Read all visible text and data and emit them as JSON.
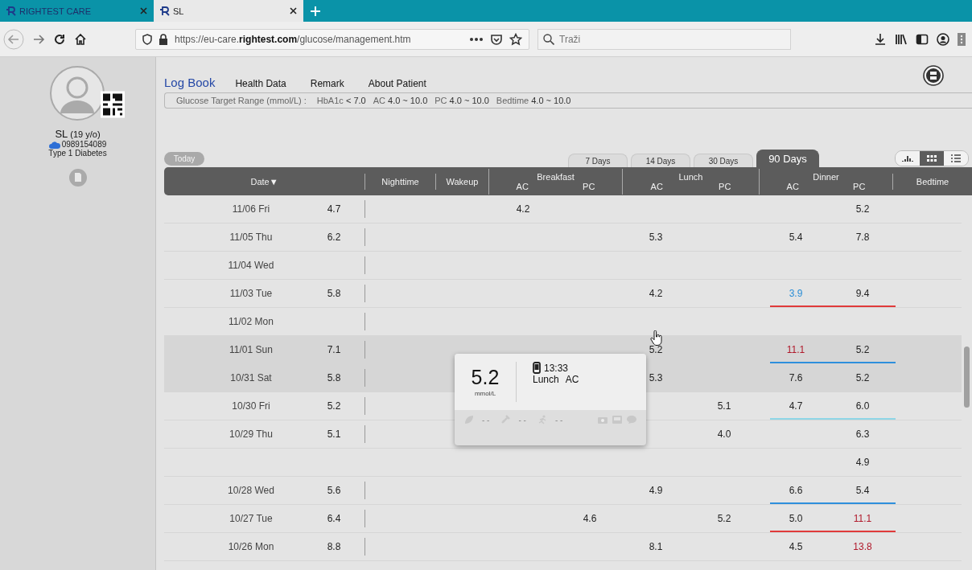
{
  "browser": {
    "tabs": [
      {
        "title": "RIGHTEST CARE",
        "selected": false
      },
      {
        "title": "SL",
        "selected": true
      }
    ],
    "url": "https://eu-care.**rightest.com**/glucose/management.htm",
    "search": {
      "placeholder": "Traži"
    }
  },
  "patient": {
    "name": "SL",
    "age": "(19 y/o)",
    "phone": "0989154089",
    "condition": "Type 1 Diabetes"
  },
  "nav": [
    {
      "label": "Log Book",
      "selected": true
    },
    {
      "label": "Health Data",
      "selected": false
    },
    {
      "label": "Remark",
      "selected": false
    },
    {
      "label": "About Patient",
      "selected": false
    }
  ],
  "target_range": {
    "label": "Glucose Target Range (mmol/L) :",
    "items": [
      {
        "name": "HbA1c",
        "value": "< 7.0"
      },
      {
        "name": "AC",
        "value": "4.0 ~ 10.0"
      },
      {
        "name": "PC",
        "value": "4.0 ~ 10.0"
      },
      {
        "name": "Bedtime",
        "value": "4.0 ~ 10.0"
      }
    ]
  },
  "today_button": "Today",
  "period_tabs": [
    {
      "label": "7 Days",
      "selected": false
    },
    {
      "label": "14 Days",
      "selected": false
    },
    {
      "label": "30 Days",
      "selected": false
    },
    {
      "label": "90 Days",
      "selected": true
    }
  ],
  "view_modes": [
    {
      "kind": "chart",
      "selected": false
    },
    {
      "kind": "grid",
      "selected": true
    },
    {
      "kind": "list",
      "selected": false
    }
  ],
  "table": {
    "date_header": "Date▼",
    "groups": [
      {
        "label": "Nighttime"
      },
      {
        "label": "Wakeup"
      },
      {
        "label": "Breakfast",
        "sub": [
          "AC",
          "PC"
        ]
      },
      {
        "label": "Lunch",
        "sub": [
          "AC",
          "PC"
        ]
      },
      {
        "label": "Dinner",
        "sub": [
          "AC",
          "PC"
        ]
      },
      {
        "label": "Bedtime"
      }
    ],
    "rows": [
      {
        "date": "11/06 Fri",
        "highlighted": false,
        "cells": {
          "column_2": {
            "value": "4.7"
          },
          "breakfast_ac": {
            "value": "4.2"
          },
          "dinner_pc": {
            "value": "5.2"
          }
        }
      },
      {
        "date": "11/05 Thu",
        "highlighted": false,
        "cells": {
          "column_2": {
            "value": "6.2"
          },
          "lunch_ac": {
            "value": "5.3"
          },
          "dinner_ac": {
            "value": "5.4"
          },
          "dinner_pc": {
            "value": "7.8"
          }
        }
      },
      {
        "date": "11/04 Wed",
        "highlighted": false,
        "cells": {}
      },
      {
        "date": "11/03 Tue",
        "highlighted": false,
        "cells": {
          "column_2": {
            "value": "5.8"
          },
          "lunch_ac": {
            "value": "4.2"
          },
          "dinner_ac": {
            "value": "3.9",
            "color": "#2b8ed6"
          },
          "dinner_pc": {
            "value": "9.4"
          }
        },
        "dinner_line": {
          "color": "#e03a3a"
        }
      },
      {
        "date": "11/02 Mon",
        "highlighted": false,
        "cells": {}
      },
      {
        "date": "11/01 Sun",
        "highlighted": true,
        "cells": {
          "column_2": {
            "value": "7.1"
          },
          "lunch_ac": {
            "value": "5.2"
          },
          "dinner_ac": {
            "value": "11.1",
            "color": "#b0182a"
          },
          "dinner_pc": {
            "value": "5.2"
          }
        },
        "dinner_line": {
          "color": "#2e8fdc"
        }
      },
      {
        "date": "10/31 Sat",
        "highlighted": true,
        "cells": {
          "column_2": {
            "value": "5.8"
          },
          "lunch_ac": {
            "value": "5.3"
          },
          "dinner_ac": {
            "value": "7.6"
          },
          "dinner_pc": {
            "value": "5.2"
          }
        }
      },
      {
        "date": "10/30 Fri",
        "highlighted": false,
        "cells": {
          "column_2": {
            "value": "5.2"
          },
          "lunch_pc": {
            "value": "5.1"
          },
          "dinner_ac": {
            "value": "4.7"
          },
          "dinner_pc": {
            "value": "6.0"
          }
        },
        "dinner_line": {
          "color": "#8fd6e6"
        }
      },
      {
        "date": "10/29 Thu",
        "highlighted": false,
        "cells": {
          "column_2": {
            "value": "5.1"
          },
          "lunch_pc": {
            "value": "4.0"
          },
          "dinner_pc": {
            "value": "6.3"
          }
        }
      },
      {
        "highlighted": false,
        "cells": {
          "dinner_pc": {
            "value": "4.9"
          }
        }
      },
      {
        "date": "10/28 Wed",
        "highlighted": false,
        "cells": {
          "column_2": {
            "value": "5.6"
          },
          "lunch_ac": {
            "value": "4.9"
          },
          "dinner_ac": {
            "value": "6.6"
          },
          "dinner_pc": {
            "value": "5.4"
          }
        },
        "dinner_line": {
          "color": "#2e8fdc"
        }
      },
      {
        "date": "10/27 Tue",
        "highlighted": false,
        "cells": {
          "column_2": {
            "value": "6.4"
          },
          "breakfast_pc": {
            "value": "4.6"
          },
          "lunch_pc": {
            "value": "5.2"
          },
          "dinner_ac": {
            "value": "5.0"
          },
          "dinner_pc": {
            "value": "11.1",
            "color": "#b0182a"
          }
        },
        "dinner_line": {
          "color": "#e03a3a"
        }
      },
      {
        "date": "10/26 Mon",
        "highlighted": false,
        "cells": {
          "column_2": {
            "value": "8.8"
          },
          "lunch_ac": {
            "value": "8.1"
          },
          "dinner_ac": {
            "value": "4.5"
          },
          "dinner_pc": {
            "value": "13.8",
            "color": "#b0182a"
          }
        }
      }
    ]
  },
  "popup": {
    "value": "5.2",
    "unit": "mmol/L",
    "time": "13:33",
    "meal": "Lunch",
    "timing": "AC",
    "details": [
      "- -",
      "- -",
      "- -"
    ]
  }
}
